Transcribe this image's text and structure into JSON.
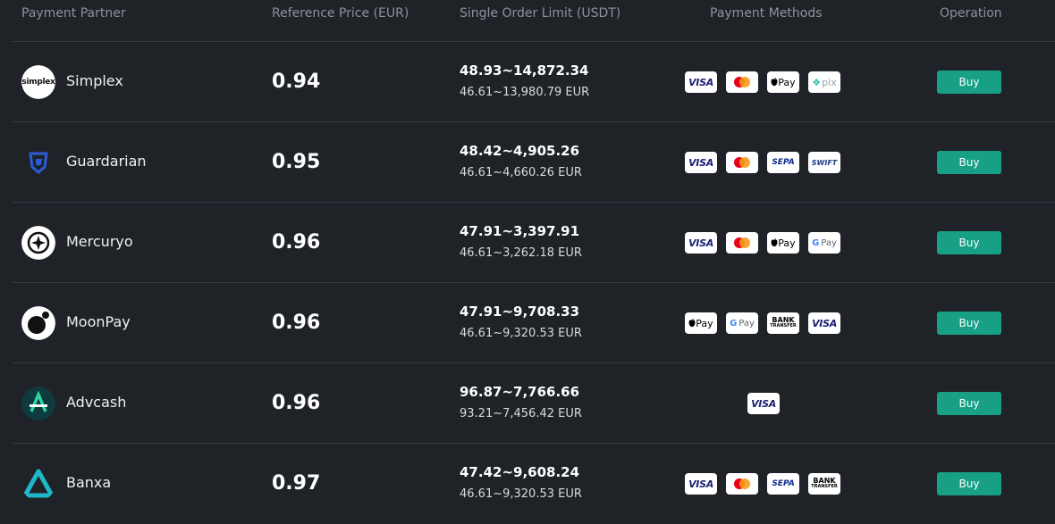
{
  "header": {
    "partner": "Payment Partner",
    "price": "Reference Price (EUR)",
    "limit": "Single Order Limit (USDT)",
    "methods": "Payment Methods",
    "operation": "Operation"
  },
  "rows": [
    {
      "name": "Simplex",
      "logo_icon": "simplex-logo",
      "logo_text": "simplex",
      "price": "0.94",
      "usdt_limit": "48.93~14,872.34",
      "eur_limit": "46.61~13,980.79 EUR",
      "methods": [
        {
          "icon": "visa-icon",
          "label": "VISA"
        },
        {
          "icon": "mastercard-icon",
          "label": ""
        },
        {
          "icon": "apple-pay-icon",
          "label": "Pay"
        },
        {
          "icon": "pix-icon",
          "label": "pix"
        }
      ],
      "buy_label": "Buy"
    },
    {
      "name": "Guardarian",
      "logo_icon": "guardarian-logo",
      "price": "0.95",
      "usdt_limit": "48.42~4,905.26",
      "eur_limit": "46.61~4,660.26 EUR",
      "methods": [
        {
          "icon": "visa-icon",
          "label": "VISA"
        },
        {
          "icon": "mastercard-icon",
          "label": ""
        },
        {
          "icon": "sepa-icon",
          "label": "SEPA"
        },
        {
          "icon": "swift-icon",
          "label": "SWIFT"
        }
      ],
      "buy_label": "Buy"
    },
    {
      "name": "Mercuryo",
      "logo_icon": "mercuryo-logo",
      "price": "0.96",
      "usdt_limit": "47.91~3,397.91",
      "eur_limit": "46.61~3,262.18 EUR",
      "methods": [
        {
          "icon": "visa-icon",
          "label": "VISA"
        },
        {
          "icon": "mastercard-icon",
          "label": ""
        },
        {
          "icon": "apple-pay-icon",
          "label": "Pay"
        },
        {
          "icon": "google-pay-icon",
          "label": "Pay"
        }
      ],
      "buy_label": "Buy"
    },
    {
      "name": "MoonPay",
      "logo_icon": "moonpay-logo",
      "price": "0.96",
      "usdt_limit": "47.91~9,708.33",
      "eur_limit": "46.61~9,320.53 EUR",
      "methods": [
        {
          "icon": "apple-pay-icon",
          "label": "Pay"
        },
        {
          "icon": "google-pay-icon",
          "label": "Pay"
        },
        {
          "icon": "bank-transfer-icon",
          "label": "BANK",
          "sub": "TRANSFER"
        },
        {
          "icon": "visa-icon",
          "label": "VISA"
        }
      ],
      "buy_label": "Buy"
    },
    {
      "name": "Advcash",
      "logo_icon": "advcash-logo",
      "price": "0.96",
      "usdt_limit": "96.87~7,766.66",
      "eur_limit": "93.21~7,456.42 EUR",
      "methods": [
        {
          "icon": "visa-icon",
          "label": "VISA"
        }
      ],
      "buy_label": "Buy"
    },
    {
      "name": "Banxa",
      "logo_icon": "banxa-logo",
      "price": "0.97",
      "usdt_limit": "47.42~9,608.24",
      "eur_limit": "46.61~9,320.53 EUR",
      "methods": [
        {
          "icon": "visa-icon",
          "label": "VISA"
        },
        {
          "icon": "mastercard-icon",
          "label": ""
        },
        {
          "icon": "sepa-icon",
          "label": "SEPA"
        },
        {
          "icon": "bank-transfer-icon",
          "label": "BANK",
          "sub": "TRANSFER"
        }
      ],
      "buy_label": "Buy"
    }
  ],
  "colors": {
    "background": "#1f2328",
    "divider": "#353b43",
    "header_text": "#8a929b",
    "buy_button": "#17a086"
  }
}
